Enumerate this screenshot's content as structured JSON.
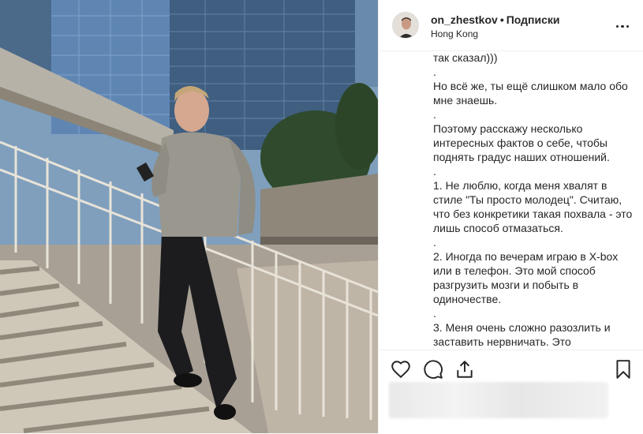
{
  "post": {
    "username": "on_zhestkov",
    "separator": "•",
    "follow_label": "Подписки",
    "location": "Hong Kong",
    "caption_lines": [
      "так сказал)))",
      ".",
      "Но всё же, ты ещё слишком мало обо мне знаешь.",
      ".",
      "Поэтому расскажу несколько интересных фактов о себе, чтобы поднять градус наших отношений.",
      ".",
      "1. Не люблю, когда меня хвалят в стиле \"Ты просто молодец\". Считаю, что без конкретики такая похвала - это лишь способ отмазаться.",
      ".",
      "2. Иногда по вечерам играю в X-box или в телефон. Это мой способ разгрузить мозги и побыть в одиночестве.",
      ".",
      "3. Меня очень сложно разозлить и заставить нервничать. Это"
    ]
  },
  "icons": {
    "more": "more-options-icon",
    "like": "heart-icon",
    "comment": "comment-icon",
    "share": "share-icon",
    "save": "bookmark-icon"
  },
  "colors": {
    "text": "#262626",
    "border": "#efefef",
    "background": "#fafafa"
  }
}
